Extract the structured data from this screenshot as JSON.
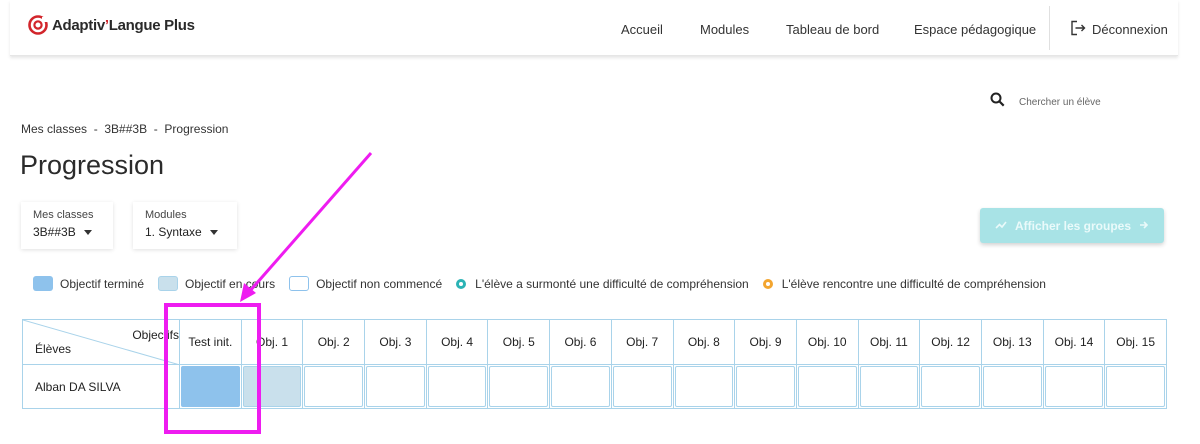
{
  "header": {
    "logo": {
      "brand": "Adaptiv",
      "accent": "’",
      "suffix": "Langue Plus"
    },
    "nav": [
      "Accueil",
      "Modules",
      "Tableau de bord",
      "Espace pédagogique"
    ],
    "logout": "Déconnexion"
  },
  "search": {
    "placeholder": "Chercher un élève"
  },
  "breadcrumb": [
    "Mes classes",
    "3B##3B",
    "Progression"
  ],
  "breadcrumb_sep": "  -  ",
  "page_title": "Progression",
  "selects": {
    "classes": {
      "label": "Mes classes",
      "value": "3B##3B"
    },
    "modules": {
      "label": "Modules",
      "value": "1. Syntaxe"
    }
  },
  "groups_button": "Afficher les groupes",
  "legend": {
    "done": "Objectif terminé",
    "in_progress": "Objectif en cours",
    "not_started": "Objectif non commencé",
    "overcame": "L'élève a surmonté une difficulté de compréhension",
    "struggling": "L'élève rencontre une difficulté de compréhension"
  },
  "table": {
    "corner_objectives": "Objectifs",
    "corner_students": "Élèves",
    "columns": [
      "Test init.",
      "Obj. 1",
      "Obj. 2",
      "Obj. 3",
      "Obj. 4",
      "Obj. 5",
      "Obj. 6",
      "Obj. 7",
      "Obj. 8",
      "Obj. 9",
      "Obj. 10",
      "Obj. 11",
      "Obj. 12",
      "Obj. 13",
      "Obj. 14",
      "Obj. 15"
    ],
    "rows": [
      {
        "student": "Alban DA SILVA",
        "status": [
          "done",
          "in_progress",
          "not_started",
          "not_started",
          "not_started",
          "not_started",
          "not_started",
          "not_started",
          "not_started",
          "not_started",
          "not_started",
          "not_started",
          "not_started",
          "not_started",
          "not_started",
          "not_started"
        ]
      }
    ]
  },
  "colors": {
    "brand_red": "#d2252b",
    "done": "#8ec2ec",
    "in_progress": "#c9e0ec",
    "not_started": "#ffffff",
    "overcame_dot": "#2bb3b5",
    "struggling_dot": "#f3a52f",
    "grid_border": "#a9d3ea",
    "annotation": "#ee1cf0"
  }
}
